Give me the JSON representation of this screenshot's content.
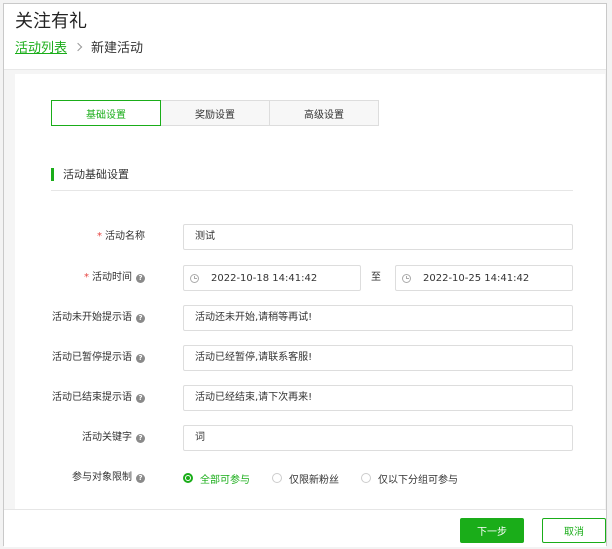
{
  "header": {
    "title": "关注有礼",
    "breadcrumb": {
      "parent": "活动列表",
      "current": "新建活动"
    }
  },
  "tabs": [
    {
      "label": "基础设置",
      "active": true
    },
    {
      "label": "奖励设置",
      "active": false
    },
    {
      "label": "高级设置",
      "active": false
    }
  ],
  "section": {
    "title": "活动基础设置"
  },
  "form": {
    "name": {
      "label": "活动名称",
      "required": true,
      "value": "测试"
    },
    "time": {
      "label": "活动时间",
      "required": true,
      "start": "2022-10-18 14:41:42",
      "separator": "至",
      "end": "2022-10-25 14:41:42"
    },
    "not_started": {
      "label": "活动未开始提示语",
      "value": "活动还未开始,请稍等再试!"
    },
    "paused": {
      "label": "活动已暂停提示语",
      "value": "活动已经暂停,请联系客服!"
    },
    "ended": {
      "label": "活动已结束提示语",
      "value": "活动已经结束,请下次再来!"
    },
    "keyword": {
      "label": "活动关键字",
      "value": "词"
    },
    "audience": {
      "label": "参与对象限制",
      "options": [
        {
          "label": "全部可参与",
          "checked": true
        },
        {
          "label": "仅限新粉丝",
          "checked": false
        },
        {
          "label": "仅以下分组可参与",
          "checked": false
        }
      ]
    }
  },
  "footer": {
    "next_label": "下一步",
    "cancel_label": "取消"
  },
  "icons": {
    "help": "?",
    "required_mark": "*"
  },
  "colors": {
    "accent": "#1aad19",
    "required": "#e64340"
  }
}
